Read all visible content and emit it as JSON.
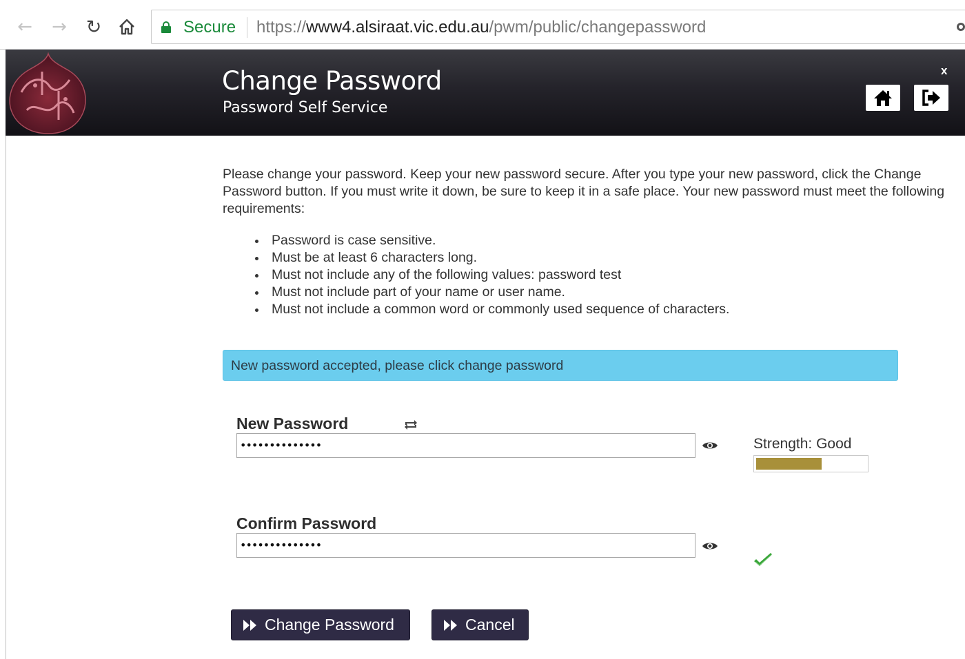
{
  "browser": {
    "secure_label": "Secure",
    "url_scheme": "https://",
    "url_host": "www4.alsiraat.vic.edu.au",
    "url_path": "/pwm/public/changepassword"
  },
  "header": {
    "title": "Change Password",
    "subtitle": "Password Self Service",
    "close_label": "x"
  },
  "intro": "Please change your password. Keep your new password secure. After you type your new password, click the Change Password button. If you must write it down, be sure to keep it in a safe place. Your new password must meet the following requirements:",
  "requirements": [
    "Password is case sensitive.",
    "Must be at least 6 characters long.",
    "Must not include any of the following values: password test",
    "Must not include part of your name or user name.",
    "Must not include a common word or commonly used sequence of characters."
  ],
  "alert": "New password accepted, please click change password",
  "new_password": {
    "label": "New Password",
    "value": "••••••••••••••"
  },
  "confirm_password": {
    "label": "Confirm Password",
    "value": "••••••••••••••"
  },
  "strength": {
    "label": "Strength:",
    "value": "Good",
    "level": 0.6,
    "color": "#a8903a"
  },
  "buttons": {
    "change": "Change Password",
    "cancel": "Cancel"
  },
  "colors": {
    "header_bg": "#1c1b21",
    "alert_bg": "#6bcdee",
    "button_bg": "#2f2b45",
    "secure_green": "#1a8a3a",
    "check_green": "#3aa53a"
  }
}
